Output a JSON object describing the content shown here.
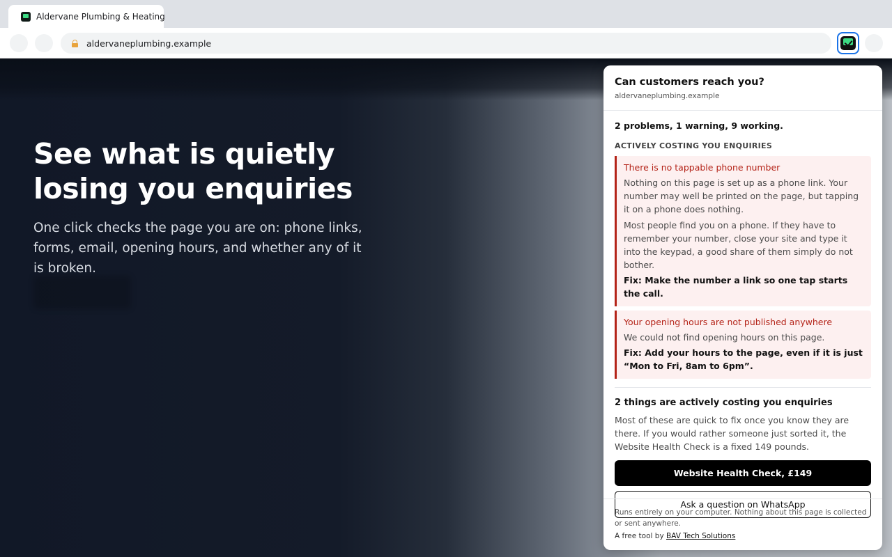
{
  "browser": {
    "tab_title": "Aldervane Plumbing & Heating",
    "url": "aldervaneplumbing.example"
  },
  "page": {
    "hero_title": "See what is quietly losing you enquiries",
    "hero_subtitle": "One click checks the page you are on: phone links, forms, email, opening hours, and whether any of it is broken."
  },
  "popup": {
    "title": "Can customers reach you?",
    "domain": "aldervaneplumbing.example",
    "summary": "2 problems, 1 warning, 9 working.",
    "section_heading": "ACTIVELY COSTING YOU ENQUIRIES",
    "issues": [
      {
        "title": "There is no tappable phone number",
        "paragraphs": [
          "Nothing on this page is set up as a phone link. Your number may well be printed on the page, but tapping it on a phone does nothing.",
          "Most people find you on a phone. If they have to remember your number, close your site and type it into the keypad, a good share of them simply do not bother."
        ],
        "fix": "Fix: Make the number a link so one tap starts the call."
      },
      {
        "title": "Your opening hours are not published anywhere",
        "paragraphs": [
          "We could not find opening hours on this page."
        ],
        "fix": "Fix: Add your hours to the page, even if it is just “Mon to Fri, 8am to 6pm”."
      }
    ],
    "cta": {
      "title": "2 things are actively costing you enquiries",
      "text": "Most of these are quick to fix once you know they are there. If you would rather someone just sorted it, the Website Health Check is a fixed 149 pounds.",
      "primary_label": "Website Health Check, £149",
      "secondary_label": "Ask a question on WhatsApp"
    },
    "footer": {
      "note": "Runs entirely on your computer. Nothing about this page is collected or sent anywhere.",
      "credit_prefix": "A free tool by ",
      "credit_link": "BAV Tech Solutions"
    }
  },
  "colors": {
    "accent_problem": "#b42318",
    "problem_bg": "#fdf0f0",
    "brand_green": "#3ddc84",
    "focus_blue": "#1a73e8"
  },
  "icons": {
    "tab_favicon": "site-favicon-icon",
    "lock": "lock-icon",
    "extension": "reach-check-extension-icon"
  }
}
